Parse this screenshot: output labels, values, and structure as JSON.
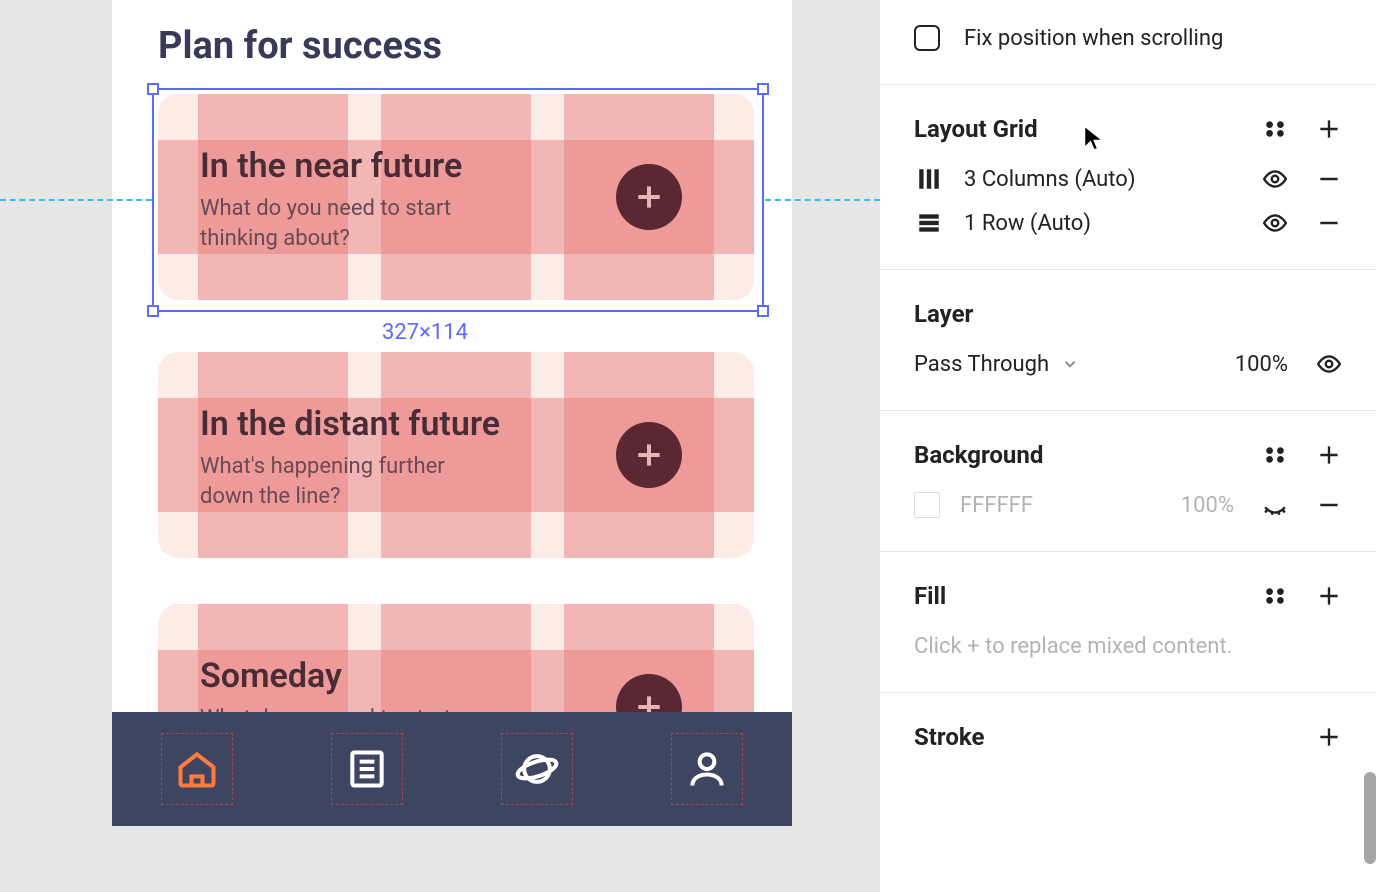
{
  "canvas": {
    "title": "Plan for success",
    "selection_size_label": "327×114",
    "cards": [
      {
        "title": "In the near future",
        "subtitle": "What do you need to start thinking about?"
      },
      {
        "title": "In the distant future",
        "subtitle": "What's happening further down the line?"
      },
      {
        "title": "Someday",
        "subtitle": "What do you need to start"
      }
    ]
  },
  "panel": {
    "fix_position_label": "Fix position when scrolling",
    "layout_grid": {
      "title": "Layout Grid",
      "items": [
        {
          "label": "3 Columns (Auto)"
        },
        {
          "label": "1 Row (Auto)"
        }
      ]
    },
    "layer": {
      "title": "Layer",
      "blend_mode": "Pass Through",
      "opacity": "100%"
    },
    "background": {
      "title": "Background",
      "hex": "FFFFFF",
      "opacity": "100%"
    },
    "fill": {
      "title": "Fill",
      "hint": "Click + to replace mixed content."
    },
    "stroke": {
      "title": "Stroke"
    }
  }
}
